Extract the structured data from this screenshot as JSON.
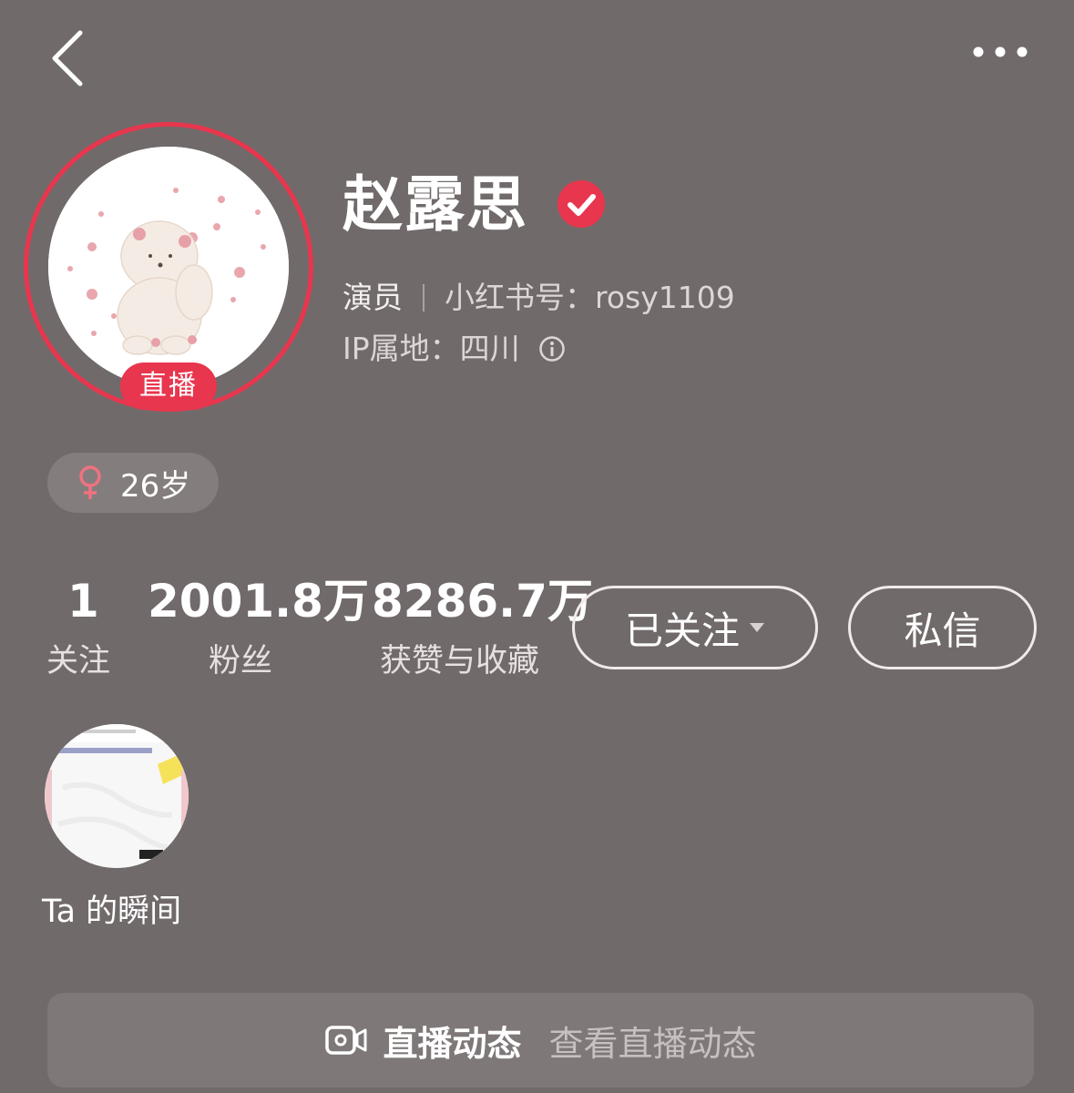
{
  "header": {
    "back_icon": "chevron-left-icon",
    "more_icon": "more-dots-icon"
  },
  "profile": {
    "name": "赵露思",
    "verified_icon": "verified-check-icon",
    "live_badge": "直播",
    "role": "演员",
    "id_label": "小红书号：rosy1109",
    "ip_label": "IP属地：四川",
    "info_icon": "info-icon",
    "age": "26岁",
    "gender_icon": "female-icon",
    "accent_color": "#e8364e"
  },
  "stats": [
    {
      "value": "1",
      "label": "关注"
    },
    {
      "value": "2001.8万",
      "label": "粉丝"
    },
    {
      "value": "8286.7万",
      "label": "获赞与收藏"
    }
  ],
  "actions": {
    "follow_label": "已关注",
    "message_label": "私信"
  },
  "moments": {
    "label": "Ta 的瞬间"
  },
  "live_bar": {
    "icon": "video-camera-icon",
    "title": "直播动态",
    "subtitle": "查看直播动态"
  }
}
